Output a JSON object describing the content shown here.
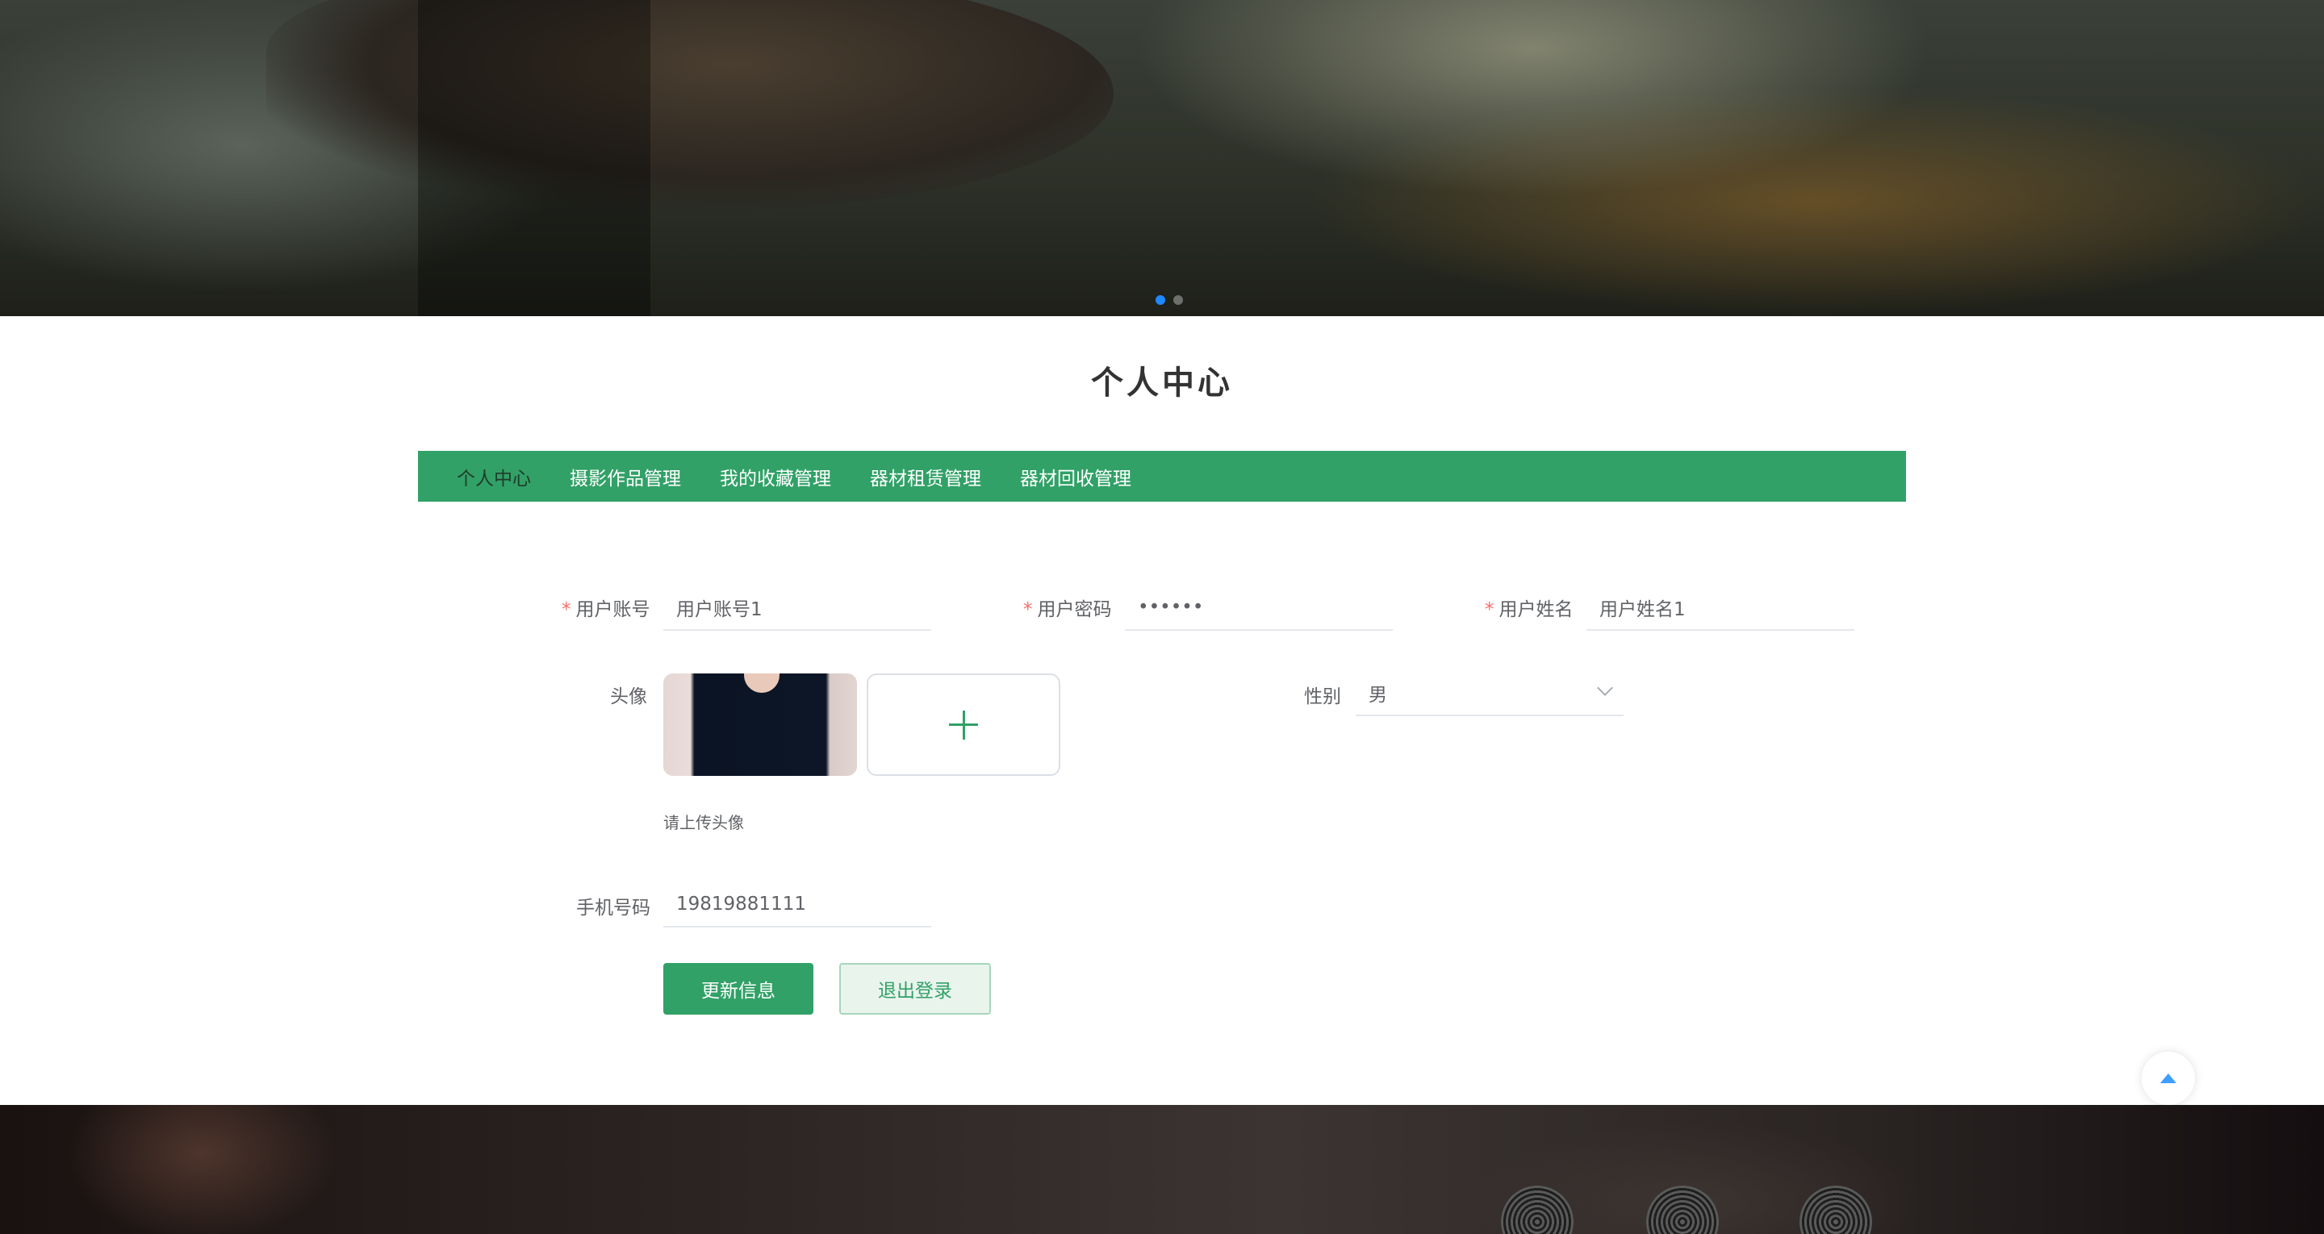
{
  "page": {
    "title": "个人中心"
  },
  "tabs": [
    {
      "label": "个人中心",
      "active": true
    },
    {
      "label": "摄影作品管理",
      "active": false
    },
    {
      "label": "我的收藏管理",
      "active": false
    },
    {
      "label": "器材租赁管理",
      "active": false
    },
    {
      "label": "器材回收管理",
      "active": false
    }
  ],
  "form": {
    "account": {
      "label": "用户账号",
      "required_mark": "*",
      "value": "用户账号1"
    },
    "password": {
      "label": "用户密码",
      "required_mark": "*",
      "value": "••••••"
    },
    "name": {
      "label": "用户姓名",
      "required_mark": "*",
      "value": "用户姓名1"
    },
    "avatar": {
      "label": "头像",
      "tip": "请上传头像"
    },
    "gender": {
      "label": "性别",
      "value": "男"
    },
    "phone": {
      "label": "手机号码",
      "value": "19819881111"
    }
  },
  "buttons": {
    "update": "更新信息",
    "logout": "退出登录"
  },
  "colors": {
    "primary": "#31a167",
    "required": "#f56c6c",
    "carousel_active": "#1e88ff"
  },
  "icons": {
    "back_to_top": "caret-up-icon",
    "upload": "plus-icon",
    "select": "chevron-down-icon"
  }
}
